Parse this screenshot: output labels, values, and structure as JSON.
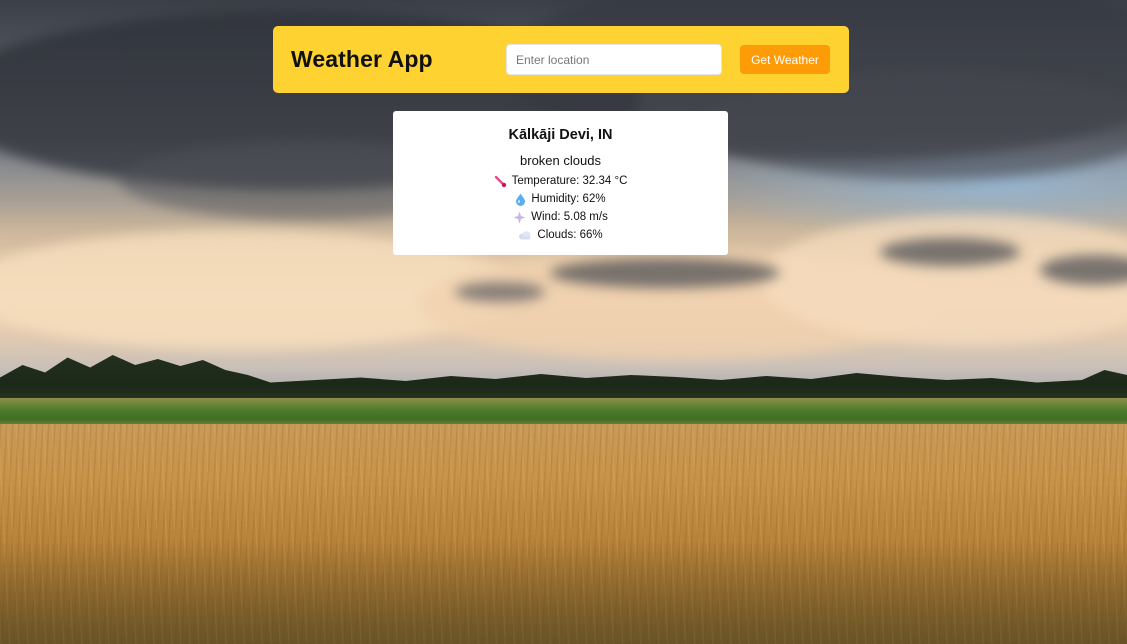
{
  "header": {
    "title": "Weather App",
    "search_placeholder": "Enter location",
    "search_value": "",
    "button_label": "Get Weather"
  },
  "weather": {
    "location": "Kālkāji Devi, IN",
    "description": "broken clouds",
    "temperature": "Temperature: 32.34 °C",
    "humidity": "Humidity: 62%",
    "wind": "Wind: 5.08 m/s",
    "clouds": "Clouds: 66%"
  },
  "icons": {
    "temperature": "thermometer-icon",
    "humidity": "droplet-icon",
    "wind": "wind-icon",
    "clouds": "cloud-icon"
  },
  "colors": {
    "header_bg": "#fed331",
    "button_bg": "#fe9c08",
    "card_bg": "#ffffff"
  }
}
